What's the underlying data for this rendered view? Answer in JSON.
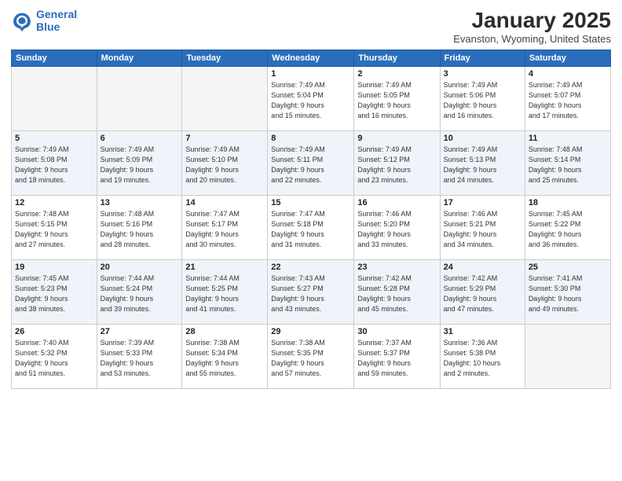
{
  "logo": {
    "line1": "General",
    "line2": "Blue"
  },
  "title": "January 2025",
  "location": "Evanston, Wyoming, United States",
  "weekdays": [
    "Sunday",
    "Monday",
    "Tuesday",
    "Wednesday",
    "Thursday",
    "Friday",
    "Saturday"
  ],
  "weeks": [
    [
      {
        "day": "",
        "info": ""
      },
      {
        "day": "",
        "info": ""
      },
      {
        "day": "",
        "info": ""
      },
      {
        "day": "1",
        "info": "Sunrise: 7:49 AM\nSunset: 5:04 PM\nDaylight: 9 hours\nand 15 minutes."
      },
      {
        "day": "2",
        "info": "Sunrise: 7:49 AM\nSunset: 5:05 PM\nDaylight: 9 hours\nand 16 minutes."
      },
      {
        "day": "3",
        "info": "Sunrise: 7:49 AM\nSunset: 5:06 PM\nDaylight: 9 hours\nand 16 minutes."
      },
      {
        "day": "4",
        "info": "Sunrise: 7:49 AM\nSunset: 5:07 PM\nDaylight: 9 hours\nand 17 minutes."
      }
    ],
    [
      {
        "day": "5",
        "info": "Sunrise: 7:49 AM\nSunset: 5:08 PM\nDaylight: 9 hours\nand 18 minutes."
      },
      {
        "day": "6",
        "info": "Sunrise: 7:49 AM\nSunset: 5:09 PM\nDaylight: 9 hours\nand 19 minutes."
      },
      {
        "day": "7",
        "info": "Sunrise: 7:49 AM\nSunset: 5:10 PM\nDaylight: 9 hours\nand 20 minutes."
      },
      {
        "day": "8",
        "info": "Sunrise: 7:49 AM\nSunset: 5:11 PM\nDaylight: 9 hours\nand 22 minutes."
      },
      {
        "day": "9",
        "info": "Sunrise: 7:49 AM\nSunset: 5:12 PM\nDaylight: 9 hours\nand 23 minutes."
      },
      {
        "day": "10",
        "info": "Sunrise: 7:49 AM\nSunset: 5:13 PM\nDaylight: 9 hours\nand 24 minutes."
      },
      {
        "day": "11",
        "info": "Sunrise: 7:48 AM\nSunset: 5:14 PM\nDaylight: 9 hours\nand 25 minutes."
      }
    ],
    [
      {
        "day": "12",
        "info": "Sunrise: 7:48 AM\nSunset: 5:15 PM\nDaylight: 9 hours\nand 27 minutes."
      },
      {
        "day": "13",
        "info": "Sunrise: 7:48 AM\nSunset: 5:16 PM\nDaylight: 9 hours\nand 28 minutes."
      },
      {
        "day": "14",
        "info": "Sunrise: 7:47 AM\nSunset: 5:17 PM\nDaylight: 9 hours\nand 30 minutes."
      },
      {
        "day": "15",
        "info": "Sunrise: 7:47 AM\nSunset: 5:18 PM\nDaylight: 9 hours\nand 31 minutes."
      },
      {
        "day": "16",
        "info": "Sunrise: 7:46 AM\nSunset: 5:20 PM\nDaylight: 9 hours\nand 33 minutes."
      },
      {
        "day": "17",
        "info": "Sunrise: 7:46 AM\nSunset: 5:21 PM\nDaylight: 9 hours\nand 34 minutes."
      },
      {
        "day": "18",
        "info": "Sunrise: 7:45 AM\nSunset: 5:22 PM\nDaylight: 9 hours\nand 36 minutes."
      }
    ],
    [
      {
        "day": "19",
        "info": "Sunrise: 7:45 AM\nSunset: 5:23 PM\nDaylight: 9 hours\nand 38 minutes."
      },
      {
        "day": "20",
        "info": "Sunrise: 7:44 AM\nSunset: 5:24 PM\nDaylight: 9 hours\nand 39 minutes."
      },
      {
        "day": "21",
        "info": "Sunrise: 7:44 AM\nSunset: 5:25 PM\nDaylight: 9 hours\nand 41 minutes."
      },
      {
        "day": "22",
        "info": "Sunrise: 7:43 AM\nSunset: 5:27 PM\nDaylight: 9 hours\nand 43 minutes."
      },
      {
        "day": "23",
        "info": "Sunrise: 7:42 AM\nSunset: 5:28 PM\nDaylight: 9 hours\nand 45 minutes."
      },
      {
        "day": "24",
        "info": "Sunrise: 7:42 AM\nSunset: 5:29 PM\nDaylight: 9 hours\nand 47 minutes."
      },
      {
        "day": "25",
        "info": "Sunrise: 7:41 AM\nSunset: 5:30 PM\nDaylight: 9 hours\nand 49 minutes."
      }
    ],
    [
      {
        "day": "26",
        "info": "Sunrise: 7:40 AM\nSunset: 5:32 PM\nDaylight: 9 hours\nand 51 minutes."
      },
      {
        "day": "27",
        "info": "Sunrise: 7:39 AM\nSunset: 5:33 PM\nDaylight: 9 hours\nand 53 minutes."
      },
      {
        "day": "28",
        "info": "Sunrise: 7:38 AM\nSunset: 5:34 PM\nDaylight: 9 hours\nand 55 minutes."
      },
      {
        "day": "29",
        "info": "Sunrise: 7:38 AM\nSunset: 5:35 PM\nDaylight: 9 hours\nand 57 minutes."
      },
      {
        "day": "30",
        "info": "Sunrise: 7:37 AM\nSunset: 5:37 PM\nDaylight: 9 hours\nand 59 minutes."
      },
      {
        "day": "31",
        "info": "Sunrise: 7:36 AM\nSunset: 5:38 PM\nDaylight: 10 hours\nand 2 minutes."
      },
      {
        "day": "",
        "info": ""
      }
    ]
  ]
}
